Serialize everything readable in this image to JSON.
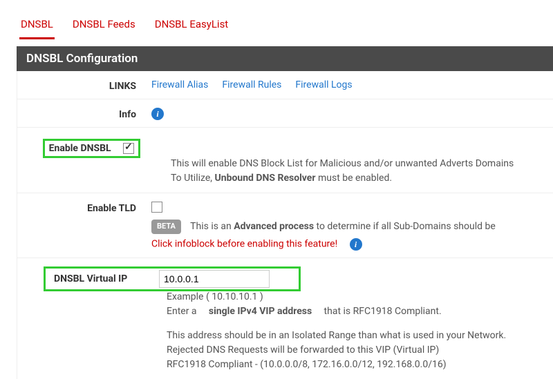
{
  "tabs": {
    "items": [
      {
        "label": "DNSBL",
        "active": true
      },
      {
        "label": "DNSBL Feeds",
        "active": false
      },
      {
        "label": "DNSBL EasyList",
        "active": false
      }
    ]
  },
  "panel": {
    "title": "DNSBL Configuration"
  },
  "links_row": {
    "label": "LINKS",
    "items": [
      "Firewall Alias",
      "Firewall Rules",
      "Firewall Logs"
    ]
  },
  "info_row": {
    "label": "Info"
  },
  "enable_dnsbl": {
    "label": "Enable DNSBL",
    "checked": true,
    "help_pre": "This will enable DNS Block List for Malicious and/or unwanted Adverts Domains",
    "help_utilize": "To Utilize, ",
    "help_bold": "Unbound DNS Resolver",
    "help_suffix": " must be enabled."
  },
  "enable_tld": {
    "label": "Enable TLD",
    "checked": false,
    "badge": "BETA",
    "line1_pre": "This is an ",
    "line1_bold": "Advanced process",
    "line1_suf": " to determine if all Sub-Domains should be",
    "warn": "Click infoblock before enabling this feature!"
  },
  "vip": {
    "label": "DNSBL Virtual IP",
    "value": "10.0.0.1",
    "example": "Example ( 10.10.10.1 )",
    "enter_pre": "Enter a",
    "enter_bold": "single IPv4 VIP address",
    "enter_suf": "that is RFC1918 Compliant.",
    "note1": "This address should be in an Isolated Range than what is used in your Network.",
    "note2": "Rejected DNS Requests will be forwarded to this VIP (Virtual IP)",
    "note3": "RFC1918 Compliant - (10.0.0.0/8, 172.16.0.0/12, 192.168.0.0/16)"
  }
}
